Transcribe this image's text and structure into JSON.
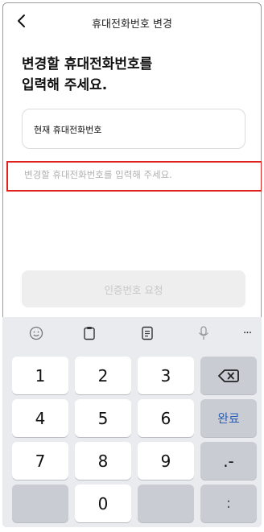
{
  "header": {
    "title": "휴대전화번호 변경"
  },
  "headline": {
    "line1": "변경할 휴대전화번호를",
    "line2": "입력해 주세요."
  },
  "current_field": {
    "label": "현재 휴대전화번호"
  },
  "new_field": {
    "placeholder": "변경할 휴대전화번호를 입력해 주세요.",
    "value": ""
  },
  "request_button": {
    "label": "인증번호 요청"
  },
  "keyboard": {
    "toolbar": [
      "emoji-icon",
      "clipboard-icon",
      "memo-icon",
      "mic-icon",
      "more-icon"
    ],
    "more_label": "···",
    "keys": {
      "k1": "1",
      "k2": "2",
      "k3": "3",
      "k4": "4",
      "k5": "5",
      "k6": "6",
      "k7": "7",
      "k8": "8",
      "k9": "9",
      "k0": "0",
      "done": "완료",
      "dot_dash": ".-",
      "colon": ":"
    }
  }
}
